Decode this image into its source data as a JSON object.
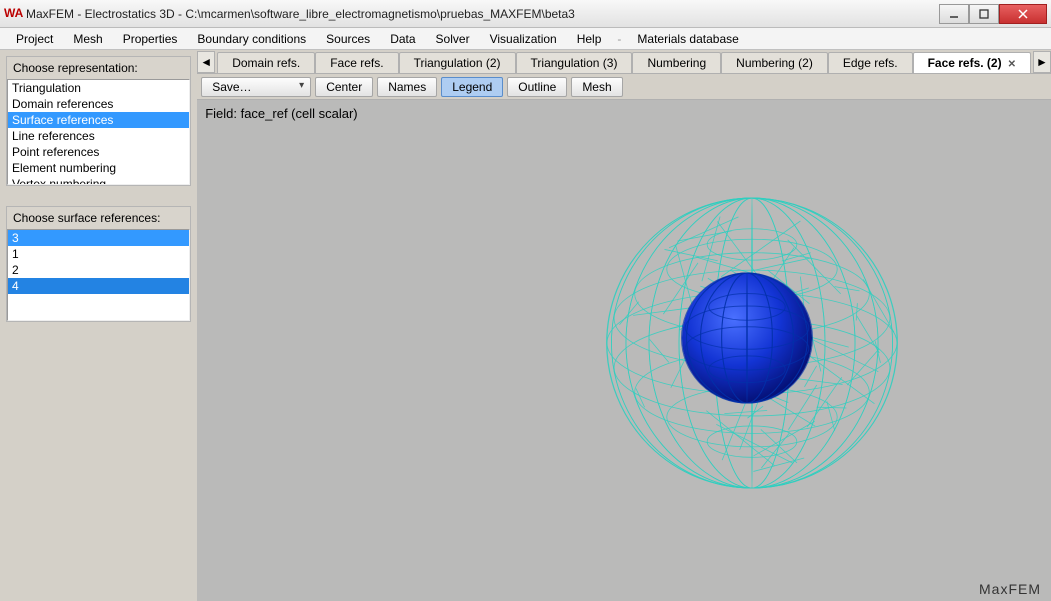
{
  "window": {
    "title": "MaxFEM - Electrostatics 3D - C:\\mcarmen\\software_libre_electromagnetismo\\pruebas_MAXFEM\\beta3",
    "app_icon": "WA"
  },
  "menu": {
    "items": [
      "Project",
      "Mesh",
      "Properties",
      "Boundary conditions",
      "Sources",
      "Data",
      "Solver",
      "Visualization",
      "Help"
    ],
    "extra": "Materials database"
  },
  "left": {
    "repr_label": "Choose representation:",
    "repr_items": [
      "Triangulation",
      "Domain references",
      "Surface references",
      "Line references",
      "Point references",
      "Element numbering",
      "Vertex numbering"
    ],
    "repr_selected_index": 2,
    "surf_label": "Choose surface references:",
    "surf_items": [
      "3",
      "1",
      "2",
      "4"
    ],
    "surf_selected_indices": [
      0,
      3
    ]
  },
  "tabs": {
    "items": [
      "Domain refs.",
      "Face refs.",
      "Triangulation (2)",
      "Triangulation (3)",
      "Numbering",
      "Numbering (2)",
      "Edge refs.",
      "Face refs. (2)"
    ],
    "active_index": 7
  },
  "toolbar": {
    "save": "Save…",
    "center": "Center",
    "names": "Names",
    "legend": "Legend",
    "outline": "Outline",
    "mesh": "Mesh",
    "legend_pressed": true
  },
  "viewport": {
    "field_label": "Field: face_ref (cell scalar)",
    "brand": "MaxFEM"
  }
}
